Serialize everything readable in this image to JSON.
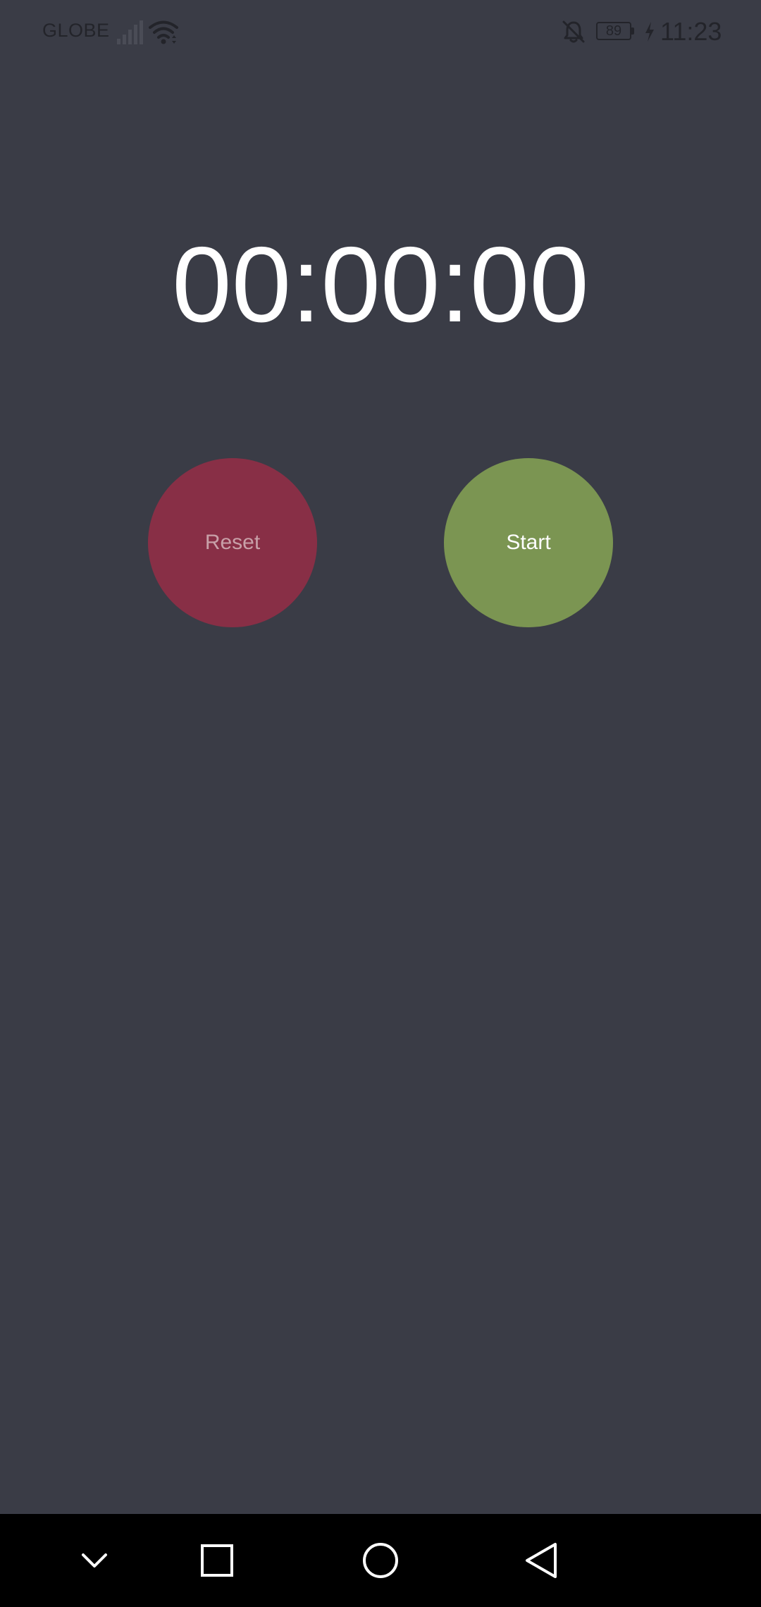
{
  "status_bar": {
    "carrier": "GLOBE",
    "battery_level": "89",
    "time": "11:23",
    "icons": [
      "signal-icon",
      "wifi-icon",
      "bell-off-icon",
      "battery-icon",
      "charging-icon"
    ]
  },
  "stopwatch": {
    "display": "00:00:00"
  },
  "controls": {
    "reset_label": "Reset",
    "start_label": "Start"
  },
  "navigation": {
    "buttons": [
      "hide-keyboard-icon",
      "recents-icon",
      "home-icon",
      "back-icon"
    ]
  },
  "colors": {
    "background": "#3a3c46",
    "reset": "#882f46",
    "start": "#7b9552",
    "nav_bar": "#000000"
  }
}
